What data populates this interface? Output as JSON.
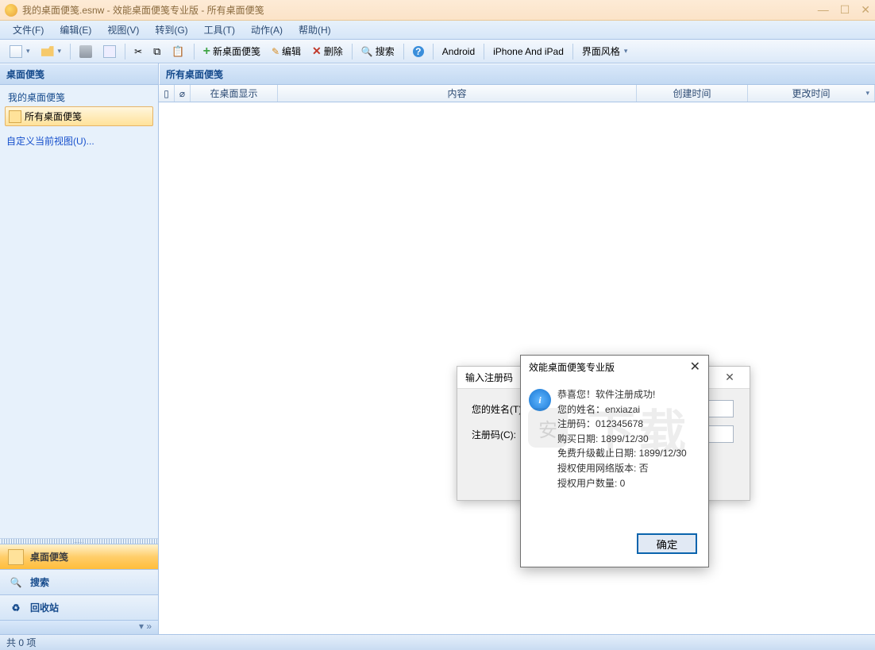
{
  "title": "我的桌面便笺.esnw - 效能桌面便笺专业版 - 所有桌面便笺",
  "menu": [
    "文件(F)",
    "编辑(E)",
    "视图(V)",
    "转到(G)",
    "工具(T)",
    "动作(A)",
    "帮助(H)"
  ],
  "toolbar": {
    "new_note": "新桌面便笺",
    "edit": "编辑",
    "delete": "删除",
    "search": "搜索",
    "android": "Android",
    "iphone": "iPhone And iPad",
    "style": "界面风格"
  },
  "sidebar": {
    "header": "桌面便笺",
    "items": [
      "我的桌面便笺",
      "所有桌面便笺"
    ],
    "custom_view": "自定义当前视图(U)...",
    "nav": {
      "notes": "桌面便笺",
      "search": "搜索",
      "recycle": "回收站"
    }
  },
  "main": {
    "header": "所有桌面便笺",
    "cols": {
      "show": "在桌面显示",
      "content": "内容",
      "created": "创建时间",
      "modified": "更改时间"
    }
  },
  "dlg_back": {
    "title": "输入注册码",
    "name_label": "您的姓名(T):",
    "code_label": "注册码(C):"
  },
  "dlg_front": {
    "title": "效能桌面便笺专业版",
    "l1": "恭喜您！软件注册成功!",
    "l2": "您的姓名：enxiazai",
    "l3": "注册码：012345678",
    "l4": "购买日期: 1899/12/30",
    "l5": "免费升级截止日期: 1899/12/30",
    "l6": "授权使用网络版本: 否",
    "l7": "授权用户数量: 0",
    "ok": "确定"
  },
  "status": "共 0 项",
  "wm_text": "下载",
  "wm_badge": "安"
}
